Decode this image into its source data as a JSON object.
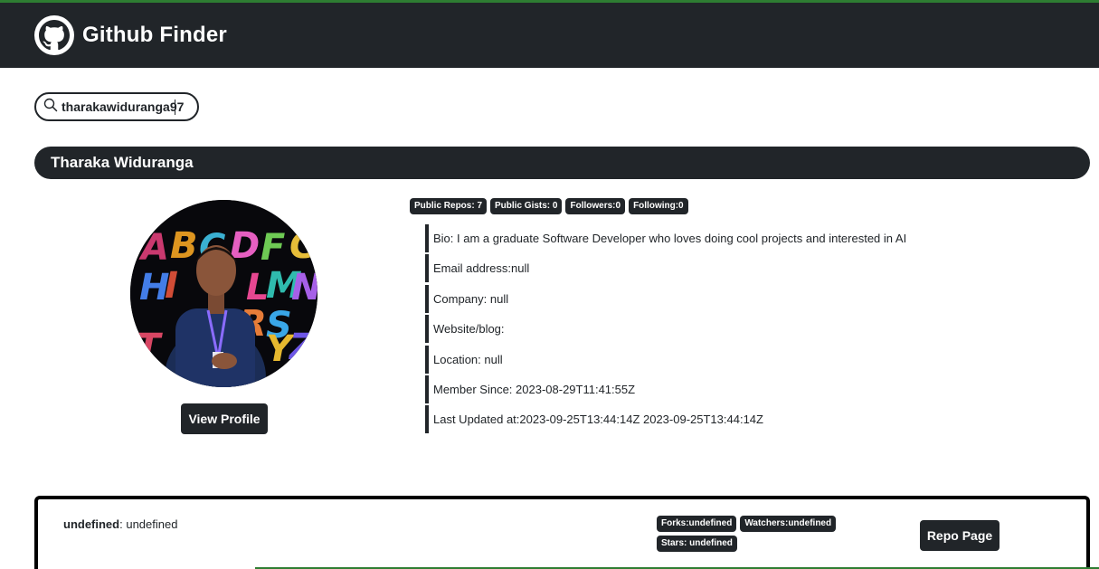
{
  "header": {
    "title": "Github Finder",
    "logo_icon": "github-octocat-icon"
  },
  "search": {
    "value": "tharakawiduranga97",
    "icon": "search-icon"
  },
  "profile": {
    "name": "Tharaka Widuranga",
    "view_profile_label": "View Profile",
    "badges": [
      "Public Repos: 7",
      "Public Gists: 0",
      "Followers:0",
      "Following:0"
    ],
    "info": [
      "Bio: I am a graduate Software Developer who loves doing cool projects and interested in AI",
      "Email address:null",
      "Company: null",
      "Website/blog:",
      "Location: null",
      "Member Since: 2023-08-29T11:41:55Z",
      "Last Updated at:2023-09-25T13:44:14Z 2023-09-25T13:44:14Z"
    ]
  },
  "repo": {
    "name": "undefined",
    "description": ": undefined",
    "badges": [
      "Forks:undefined",
      "Watchers:undefined",
      "Stars: undefined"
    ],
    "button_label": "Repo Page"
  },
  "colors": {
    "dark": "#212529",
    "accent_line": "#2e7d32"
  }
}
